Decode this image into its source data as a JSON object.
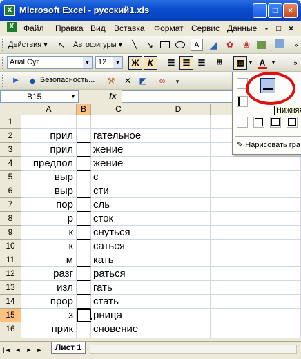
{
  "window": {
    "title": "Microsoft Excel - русский1.xls",
    "icon_letter": "X",
    "buttons": [
      "_",
      "□",
      "×"
    ]
  },
  "menu": {
    "items": [
      "Файл",
      "Правка",
      "Вид",
      "Вставка",
      "Формат",
      "Сервис",
      "Данные"
    ],
    "right_controls": [
      "-",
      "□",
      "×"
    ]
  },
  "toolbar_drawing": {
    "actions_label": "Действия ▾",
    "autoshapes_label": "Автофигуры ▾"
  },
  "toolbar_format": {
    "font": "Arial Cyr",
    "size": "12",
    "bold": "Ж",
    "italic": "К"
  },
  "toolbar_security": {
    "label": "Безопасность..."
  },
  "formula_bar": {
    "name_box": "B15",
    "fx": "fx",
    "formula": ""
  },
  "grid": {
    "columns": [
      "A",
      "B",
      "C",
      "D"
    ],
    "selected_column": "B",
    "selected_row": 15,
    "rows": [
      {
        "n": "1",
        "a": "",
        "c": ""
      },
      {
        "n": "2",
        "a": "прил",
        "c": "гательное"
      },
      {
        "n": "3",
        "a": "прил",
        "c": "жение"
      },
      {
        "n": "4",
        "a": "предпол",
        "c": "жение"
      },
      {
        "n": "5",
        "a": "выр",
        "c": "с"
      },
      {
        "n": "6",
        "a": "выр",
        "c": "сти"
      },
      {
        "n": "7",
        "a": "пор",
        "c": "сль"
      },
      {
        "n": "8",
        "a": "р",
        "c": "сток"
      },
      {
        "n": "9",
        "a": "к",
        "c": "снуться"
      },
      {
        "n": "10",
        "a": "к",
        "c": "саться"
      },
      {
        "n": "11",
        "a": "м",
        "c": "кать"
      },
      {
        "n": "12",
        "a": "разг",
        "c": "раться"
      },
      {
        "n": "13",
        "a": "изл",
        "c": "гать"
      },
      {
        "n": "14",
        "a": "прор",
        "c": "стать"
      },
      {
        "n": "15",
        "a": "з",
        "c": "рница"
      },
      {
        "n": "16",
        "a": "прик",
        "c": "сновение"
      },
      {
        "n": "17",
        "a": "",
        "c": ""
      }
    ]
  },
  "sheets": {
    "active": "Лист 1",
    "nav": [
      "|◄",
      "◄",
      "►",
      "►|"
    ]
  },
  "border_popup": {
    "tooltip": "Нижняя",
    "draw_label": "Нарисовать гра"
  },
  "colors": {
    "title_bar": "#0a4fd0",
    "selection_header": "#ffc080",
    "highlight_circle": "#e01010",
    "font_color_bar": "#e01010"
  }
}
